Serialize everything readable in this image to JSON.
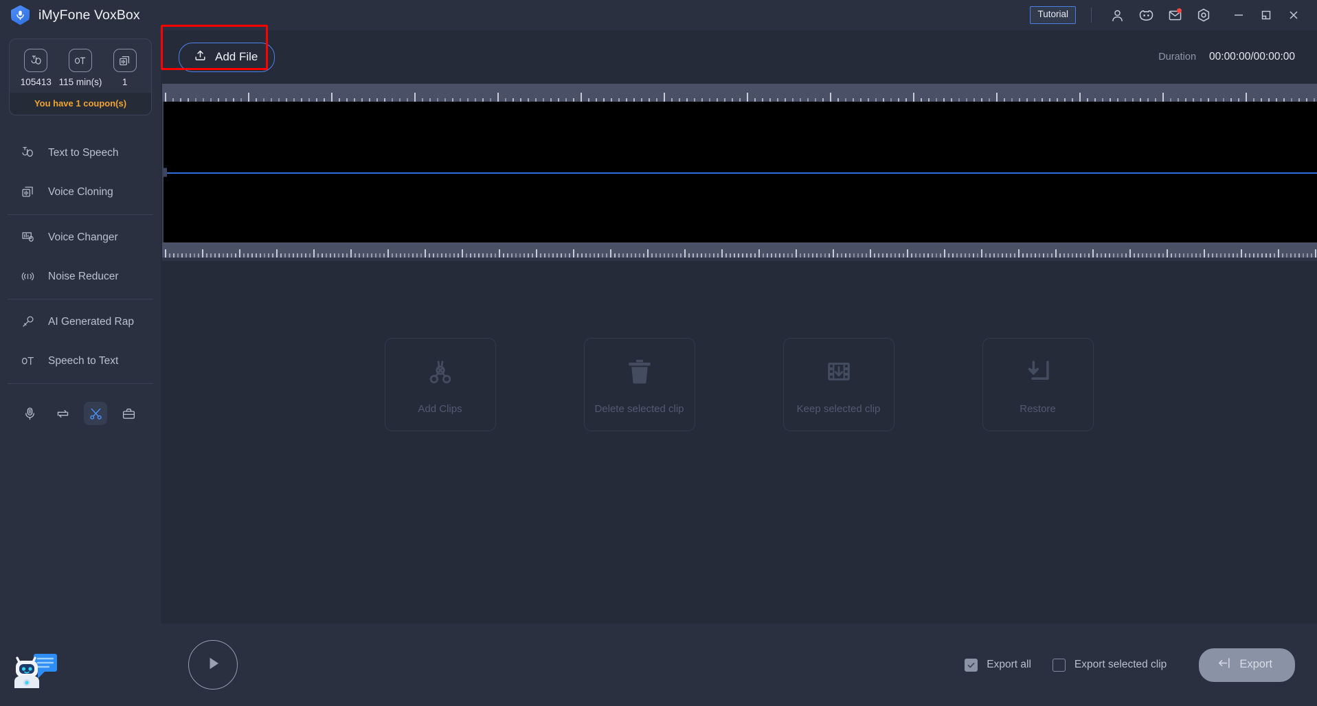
{
  "app": {
    "title": "iMyFone VoxBox",
    "logo_icon": "voxbox-logo-icon"
  },
  "titlebar": {
    "tutorial_label": "Tutorial",
    "icons": [
      {
        "name": "account-icon",
        "label": "Account"
      },
      {
        "name": "discord-icon",
        "label": "Discord"
      },
      {
        "name": "mail-icon",
        "label": "Mail"
      },
      {
        "name": "settings-icon",
        "label": "Settings"
      }
    ],
    "window_controls": [
      {
        "name": "minimize-button",
        "label": "Minimize"
      },
      {
        "name": "maximize-button",
        "label": "Maximize"
      },
      {
        "name": "close-button",
        "label": "Close"
      }
    ]
  },
  "sidebar": {
    "credits": [
      {
        "icon": "text-to-speech-icon",
        "value": "105413"
      },
      {
        "icon": "speech-to-text-icon",
        "value": "115 min(s)"
      },
      {
        "icon": "voice-cloning-icon",
        "value": "1"
      }
    ],
    "coupon_text": "You have 1 coupon(s)",
    "items": [
      {
        "icon": "text-to-speech-icon",
        "label": "Text to Speech"
      },
      {
        "icon": "voice-cloning-icon",
        "label": "Voice Cloning"
      },
      {
        "icon": "voice-changer-icon",
        "label": "Voice Changer"
      },
      {
        "icon": "noise-reducer-icon",
        "label": "Noise Reducer"
      },
      {
        "icon": "ai-generated-rap-icon",
        "label": "AI Generated Rap"
      },
      {
        "icon": "speech-to-text-icon",
        "label": "Speech to Text"
      }
    ],
    "tools": [
      {
        "icon": "recorder-icon",
        "label": "Recorder",
        "active": false
      },
      {
        "icon": "converter-icon",
        "label": "Converter",
        "active": false
      },
      {
        "icon": "cutter-icon",
        "label": "Audio Cutter",
        "active": true
      },
      {
        "icon": "toolbox-icon",
        "label": "Toolbox",
        "active": false
      }
    ],
    "chatbot_icon": "chatbot-assistant-icon"
  },
  "toolbar": {
    "add_file_label": "Add File",
    "add_file_icon": "upload-icon",
    "duration_label": "Duration",
    "duration_value": "00:00:00/00:00:00"
  },
  "clip_actions": [
    {
      "icon": "scissors-x-icon",
      "label": "Add Clips"
    },
    {
      "icon": "trash-icon",
      "label": "Delete selected clip"
    },
    {
      "icon": "film-down-icon",
      "label": "Keep selected clip"
    },
    {
      "icon": "restore-icon",
      "label": "Restore"
    }
  ],
  "bottombar": {
    "play_icon": "play-icon",
    "export_all_label": "Export all",
    "export_all_checked": true,
    "export_selected_label": "Export selected clip",
    "export_selected_checked": false,
    "export_button_label": "Export",
    "export_button_icon": "export-icon"
  },
  "colors": {
    "accent_blue": "#4a84ea",
    "coupon_orange": "#f0a431",
    "highlight_red": "#ff0000",
    "titlebar_bg": "#2a3040",
    "main_bg": "#262b3a",
    "ruler_bg": "#4a5167",
    "waveform_bg": "#000000",
    "notification_red": "#f5453c"
  }
}
